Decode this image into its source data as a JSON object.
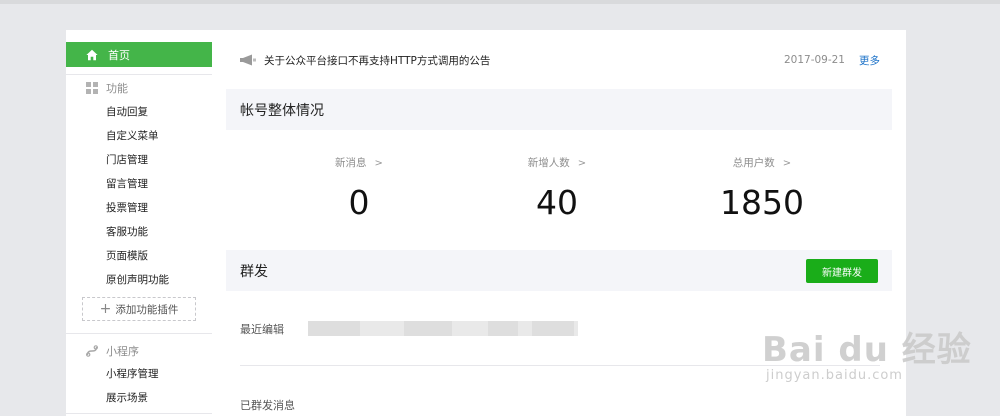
{
  "sidebar": {
    "home_label": "首页",
    "groups": [
      {
        "title": "功能",
        "items": [
          "自动回复",
          "自定义菜单",
          "门店管理",
          "留言管理",
          "投票管理",
          "客服功能",
          "页面模版",
          "原创声明功能"
        ],
        "add_label": "添加功能插件"
      },
      {
        "title": "小程序",
        "items": [
          "小程序管理",
          "展示场景"
        ]
      }
    ]
  },
  "notice": {
    "text": "关于公众平台接口不再支持HTTP方式调用的公告",
    "date": "2017-09-21",
    "more": "更多"
  },
  "account": {
    "title": "帐号整体情况",
    "stats": [
      {
        "label": "新消息",
        "value": "0"
      },
      {
        "label": "新增人数",
        "value": "40"
      },
      {
        "label": "总用户数",
        "value": "1850"
      }
    ]
  },
  "mass": {
    "title": "群发",
    "new_button": "新建群发",
    "recent_label": "最近编辑",
    "sent_label": "已群发消息"
  },
  "watermark": {
    "brand": "Bai du 经验",
    "url": "jingyan.baidu.com"
  },
  "colors": {
    "accent": "#44b549",
    "button": "#1aad19",
    "link": "#1e73c8"
  }
}
